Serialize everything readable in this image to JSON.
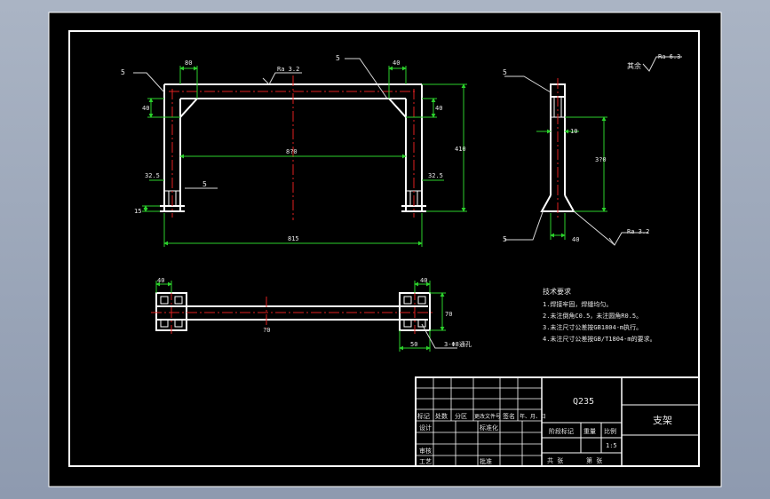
{
  "colors": {
    "background": "#000000",
    "line": "#ffffff",
    "dimension": "#2bd12b",
    "centerline": "#e02020",
    "leader": "#d8d8d8",
    "text": "#e8e8e8"
  },
  "front_view": {
    "dim_top_left": "80",
    "dim_top_right": "40",
    "dim_left_height": "40",
    "dim_right_height": "40",
    "dim_inner_width": "8?0",
    "dim_total_height": "410",
    "dim_left_offset": "32.5",
    "dim_right_offset": "32.5",
    "dim_base": "15",
    "dim_total_width": "815",
    "roughness_label": "Ra 3.2",
    "weld_left": "5",
    "weld_right": "5",
    "weld_foot": "5"
  },
  "side_view": {
    "weld_top": "5",
    "weld_bottom": "5",
    "dim_middle": "10",
    "dim_height": "3?0",
    "dim_base": "40",
    "roughness_label": "Ra 3.2"
  },
  "top_view": {
    "dim_left": "40",
    "dim_right": "40",
    "dim_center": "?0",
    "dim_right_h": "70",
    "dim_bottom": "50",
    "callout": "3-Φ8通孔"
  },
  "roughness_note": {
    "prefix": "其余",
    "value": "Ra 6.3"
  },
  "tech_requirements": {
    "title": "技术要求",
    "items": [
      "1.焊接牢固，焊缝均匀。",
      "2.未注倒角C0.5，未注圆角R0.5。",
      "3.未注尺寸公差按GB1804-m执行。",
      "4.未注尺寸公差按GB/T1804-m的要求。"
    ]
  },
  "title_block": {
    "material": "Q235",
    "part_name": "支架",
    "revision_headers": [
      "标记",
      "处数",
      "分区",
      "更改文件号",
      "签名",
      "年、月、日"
    ],
    "row_design": "设计",
    "row_standard": "标准化",
    "row_review": "审核",
    "row_process": "工艺",
    "row_approve": "批准",
    "stage_label": "阶段标记",
    "weight_label": "重量",
    "scale_label": "比例",
    "scale_value": "1:5",
    "sheet_total": "共  张",
    "sheet_num": "第  张"
  }
}
